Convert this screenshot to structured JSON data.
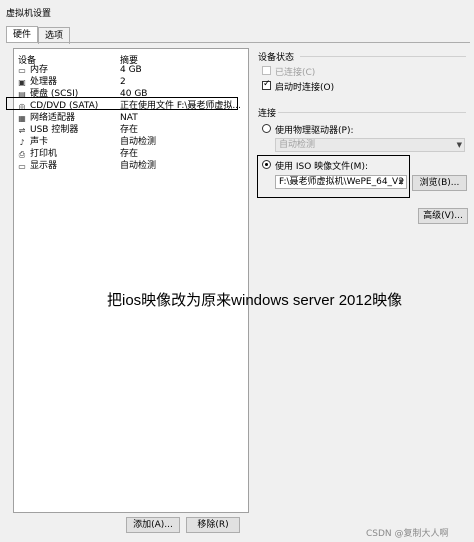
{
  "window": {
    "title": "虚拟机设置"
  },
  "tabs": [
    {
      "label": "硬件",
      "active": true
    },
    {
      "label": "选项",
      "active": false
    }
  ],
  "device_list": {
    "col_device": "设备",
    "col_summary": "摘要",
    "rows": [
      {
        "icon": "memory-icon",
        "name": "内存",
        "value": "4 GB"
      },
      {
        "icon": "cpu-icon",
        "name": "处理器",
        "value": "2"
      },
      {
        "icon": "disk-icon",
        "name": "硬盘 (SCSI)",
        "value": "40 GB"
      },
      {
        "icon": "cd-dvd-icon",
        "name": "CD/DVD (SATA)",
        "value": "正在使用文件 F:\\聂老师虚拟..."
      },
      {
        "icon": "network-icon",
        "name": "网络适配器",
        "value": "NAT"
      },
      {
        "icon": "usb-icon",
        "name": "USB 控制器",
        "value": "存在"
      },
      {
        "icon": "sound-icon",
        "name": "声卡",
        "value": "自动检测"
      },
      {
        "icon": "printer-icon",
        "name": "打印机",
        "value": "存在"
      },
      {
        "icon": "display-icon",
        "name": "显示器",
        "value": "自动检测"
      }
    ]
  },
  "buttons": {
    "add": "添加(A)...",
    "remove": "移除(R)"
  },
  "device_status": {
    "title": "设备状态",
    "connected": {
      "label": "已连接(C)",
      "checked": false,
      "disabled": true
    },
    "connect_on_power": {
      "label": "启动时连接(O)",
      "checked": true
    }
  },
  "connection": {
    "title": "连接",
    "physical": {
      "label": "使用物理驱动器(P):",
      "selected": false
    },
    "physical_select": "自动检测",
    "iso": {
      "label": "使用 ISO 映像文件(M):",
      "selected": true
    },
    "iso_path": "F:\\聂老师虚拟机\\WePE_64_V2",
    "browse": "浏览(B)...",
    "advanced": "高级(V)..."
  },
  "annotation": "把ios映像改为原来windows server 2012映像",
  "watermark": "CSDN @复制大人啊"
}
